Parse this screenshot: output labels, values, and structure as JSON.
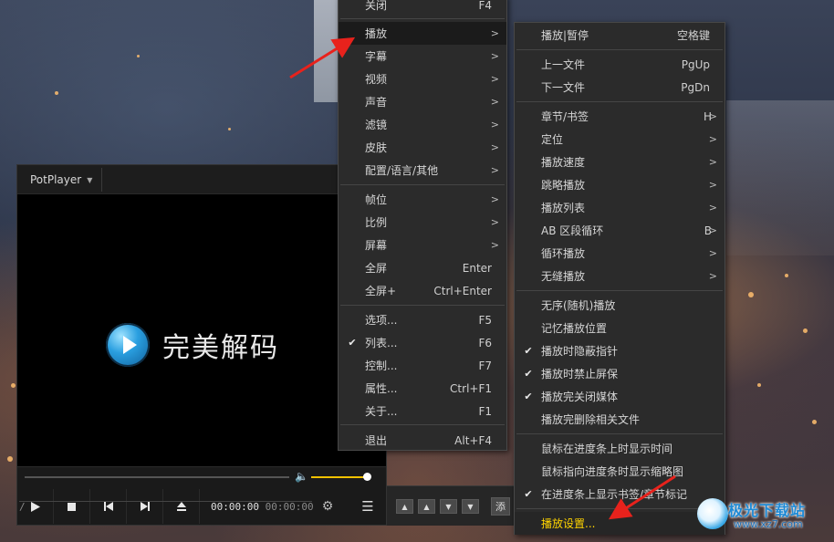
{
  "player": {
    "brand": "PotPlayer",
    "video_logo_text": "完美解码",
    "time_current": "00:00:00",
    "time_separator": "/",
    "time_total": "00:00:00",
    "volume_level": 0.95
  },
  "side_panel": {
    "add_label": "添"
  },
  "main_menu": {
    "items": [
      {
        "label": "关闭",
        "shortcut": "F4",
        "arrow": ""
      },
      {
        "label": "播放",
        "shortcut": "",
        "arrow": ">"
      },
      {
        "label": "字幕",
        "shortcut": "",
        "arrow": ">"
      },
      {
        "label": "视频",
        "shortcut": "",
        "arrow": ">"
      },
      {
        "label": "声音",
        "shortcut": "",
        "arrow": ">"
      },
      {
        "label": "滤镜",
        "shortcut": "",
        "arrow": ">"
      },
      {
        "label": "皮肤",
        "shortcut": "",
        "arrow": ">"
      },
      {
        "label": "配置/语言/其他",
        "shortcut": "",
        "arrow": ">"
      },
      {
        "label": "帧位",
        "shortcut": "",
        "arrow": ">"
      },
      {
        "label": "比例",
        "shortcut": "",
        "arrow": ">"
      },
      {
        "label": "屏幕",
        "shortcut": "",
        "arrow": ">"
      },
      {
        "label": "全屏",
        "shortcut": "Enter",
        "arrow": ""
      },
      {
        "label": "全屏+",
        "shortcut": "Ctrl+Enter",
        "arrow": ""
      },
      {
        "label": "选项...",
        "shortcut": "F5",
        "arrow": ""
      },
      {
        "label": "列表...",
        "shortcut": "F6",
        "arrow": "",
        "checked": true
      },
      {
        "label": "控制...",
        "shortcut": "F7",
        "arrow": ""
      },
      {
        "label": "属性...",
        "shortcut": "Ctrl+F1",
        "arrow": ""
      },
      {
        "label": "关于...",
        "shortcut": "F1",
        "arrow": ""
      },
      {
        "label": "退出",
        "shortcut": "Alt+F4",
        "arrow": ""
      }
    ]
  },
  "sub_menu": {
    "items": [
      {
        "label": "播放|暂停",
        "shortcut": "空格键",
        "arrow": ""
      },
      {
        "label": "上一文件",
        "shortcut": "PgUp",
        "arrow": ""
      },
      {
        "label": "下一文件",
        "shortcut": "PgDn",
        "arrow": ""
      },
      {
        "label": "章节/书签",
        "shortcut": "H",
        "arrow": ">"
      },
      {
        "label": "定位",
        "shortcut": "",
        "arrow": ">"
      },
      {
        "label": "播放速度",
        "shortcut": "",
        "arrow": ">"
      },
      {
        "label": "跳略播放",
        "shortcut": "",
        "arrow": ">"
      },
      {
        "label": "播放列表",
        "shortcut": "",
        "arrow": ">"
      },
      {
        "label": "AB 区段循环",
        "shortcut": "B",
        "arrow": ">"
      },
      {
        "label": "循环播放",
        "shortcut": "",
        "arrow": ">"
      },
      {
        "label": "无缝播放",
        "shortcut": "",
        "arrow": ">"
      },
      {
        "label": "无序(随机)播放",
        "shortcut": "",
        "arrow": ""
      },
      {
        "label": "记忆播放位置",
        "shortcut": "",
        "arrow": ""
      },
      {
        "label": "播放时隐蔽指针",
        "shortcut": "",
        "arrow": "",
        "checked": true
      },
      {
        "label": "播放时禁止屏保",
        "shortcut": "",
        "arrow": "",
        "checked": true
      },
      {
        "label": "播放完关闭媒体",
        "shortcut": "",
        "arrow": "",
        "checked": true
      },
      {
        "label": "播放完删除相关文件",
        "shortcut": "",
        "arrow": ""
      },
      {
        "label": "鼠标在进度条上时显示时间",
        "shortcut": "",
        "arrow": ""
      },
      {
        "label": "鼠标指向进度条时显示缩略图",
        "shortcut": "",
        "arrow": ""
      },
      {
        "label": "在进度条上显示书签/章节标记",
        "shortcut": "",
        "arrow": "",
        "checked": true
      },
      {
        "label": "播放设置...",
        "shortcut": "",
        "arrow": ""
      }
    ]
  },
  "watermark": {
    "name": "极光下载站",
    "url": "www.xz7.com"
  },
  "colors": {
    "menu_bg": "#2b2b2b",
    "menu_text": "#d6d6d6",
    "highlight_text": "#ffd400",
    "annotation_red": "#e8221c",
    "volume_fill": "#f2c200"
  },
  "icons": {
    "play": "play-icon",
    "stop": "stop-icon",
    "prev": "previous-icon",
    "next": "next-icon",
    "eject": "eject-icon",
    "settings": "gear-icon",
    "menu": "hamburger-menu-icon",
    "volume": "volume-icon",
    "check": "checkmark-icon",
    "submenu": "chevron-right-icon"
  }
}
